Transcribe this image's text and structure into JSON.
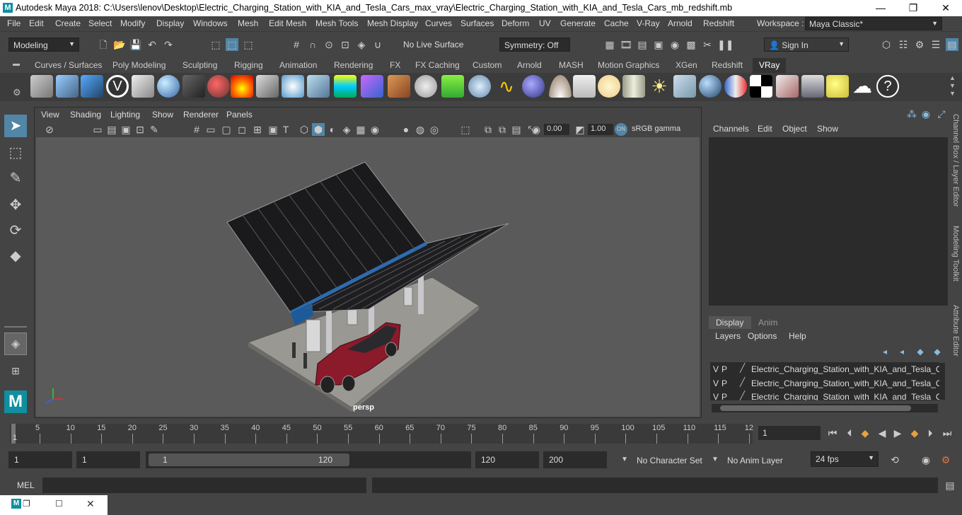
{
  "window": {
    "title": "Autodesk Maya 2018: C:\\Users\\lenov\\Desktop\\Electric_Charging_Station_with_KIA_and_Tesla_Cars_max_vray\\Electric_Charging_Station_with_KIA_and_Tesla_Cars_mb_redshift.mb",
    "minimize": "—",
    "maximize": "❐",
    "close": "✕"
  },
  "menubar": {
    "items": [
      "File",
      "Edit",
      "Create",
      "Select",
      "Modify",
      "Display",
      "Windows",
      "Mesh",
      "Edit Mesh",
      "Mesh Tools",
      "Mesh Display",
      "Curves",
      "Surfaces",
      "Deform",
      "UV",
      "Generate",
      "Cache",
      "V-Ray",
      "Arnold",
      "Redshift"
    ],
    "workspace_label": "Workspace :",
    "workspace_value": "Maya Classic*"
  },
  "statusline": {
    "mode": "Modeling",
    "live_surface": "No Live Surface",
    "symmetry": "Symmetry: Off",
    "sign_in": "Sign In"
  },
  "shelf": {
    "tabs": [
      "Curves / Surfaces",
      "Poly Modeling",
      "Sculpting",
      "Rigging",
      "Animation",
      "Rendering",
      "FX",
      "FX Caching",
      "Custom",
      "Arnold",
      "MASH",
      "Motion Graphics",
      "XGen",
      "Redshift",
      "VRay"
    ],
    "active_tab": "VRay"
  },
  "viewport": {
    "menus": [
      "View",
      "Shading",
      "Lighting",
      "Show",
      "Renderer",
      "Panels"
    ],
    "exposure": "0.00",
    "gamma": "1.00",
    "color_space": "sRGB gamma",
    "camera_label": "persp"
  },
  "channelbox": {
    "menus": [
      "Channels",
      "Edit",
      "Object",
      "Show"
    ],
    "tabs": [
      "Display",
      "Anim"
    ],
    "active_tab": "Display",
    "layer_menus": [
      "Layers",
      "Options",
      "Help"
    ],
    "layers": [
      {
        "v": "V",
        "p": "P",
        "name": "Electric_Charging_Station_with_KIA_and_Tesla_Cars"
      },
      {
        "v": "V",
        "p": "P",
        "name": "Electric_Charging_Station_with_KIA_and_Tesla_Cars"
      },
      {
        "v": "V",
        "p": "P",
        "name": "Electric_Charging_Station_with_KIA_and_Tesla_Cars"
      }
    ],
    "side_tabs": [
      "Channel Box / Layer Editor",
      "Modeling Toolkit",
      "Attribute Editor"
    ]
  },
  "timeline": {
    "ticks": [
      "5",
      "10",
      "15",
      "20",
      "25",
      "30",
      "35",
      "40",
      "45",
      "50",
      "55",
      "60",
      "65",
      "70",
      "75",
      "80",
      "85",
      "90",
      "95",
      "100",
      "105",
      "110",
      "115",
      "12"
    ],
    "start_marker": "1",
    "current_frame": "1"
  },
  "range": {
    "start": "1",
    "playback_start": "1",
    "slider_start": "1",
    "slider_end": "120",
    "playback_end": "120",
    "end": "200",
    "character_set": "No Character Set",
    "anim_layer": "No Anim Layer",
    "fps": "24 fps"
  },
  "mel": {
    "label": "MEL"
  },
  "colors": {
    "panel": "#444444",
    "field": "#2b2b2b",
    "accent": "#5285a6",
    "car": "#8b1a2b"
  }
}
